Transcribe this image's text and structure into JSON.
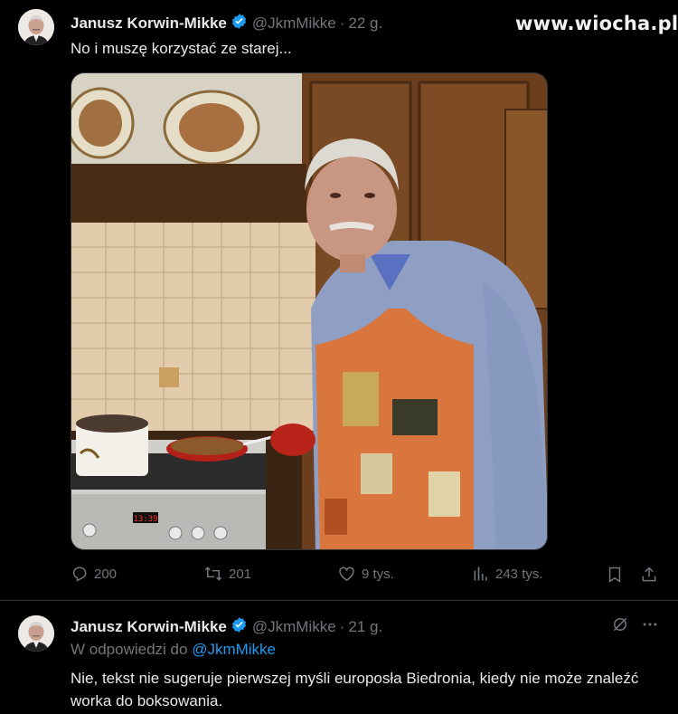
{
  "watermark": "www.wiocha.pl",
  "tweet1": {
    "author_name": "Janusz Korwin-Mikke",
    "handle": "@JkmMikke",
    "separator": "·",
    "time": "22 g.",
    "text": "No i muszę korzystać ze starej...",
    "stats": {
      "replies": "200",
      "reposts": "201",
      "likes": "9 tys.",
      "views": "243 tys."
    },
    "stove_clock": "13:39"
  },
  "tweet2": {
    "author_name": "Janusz Korwin-Mikke",
    "handle": "@JkmMikke",
    "separator": "·",
    "time": "21 g.",
    "reply_prefix": "W odpowiedzi do",
    "reply_mention": "@JkmMikke",
    "text": "Nie, tekst nie sugeruje pierwszej myśli europosła Biedronia, kiedy nie może znaleźć worka do boksowania."
  },
  "icons": {
    "verified": "verified-badge-icon",
    "reply": "reply-icon",
    "repost": "repost-icon",
    "like": "heart-icon",
    "views": "bar-chart-icon",
    "bookmark": "bookmark-icon",
    "share": "share-icon",
    "grok": "grok-icon",
    "more": "more-icon"
  },
  "colors": {
    "background": "#000000",
    "text": "#e7e9ea",
    "muted": "#71767b",
    "accent": "#1d9bf0",
    "divider": "#2f3336"
  }
}
